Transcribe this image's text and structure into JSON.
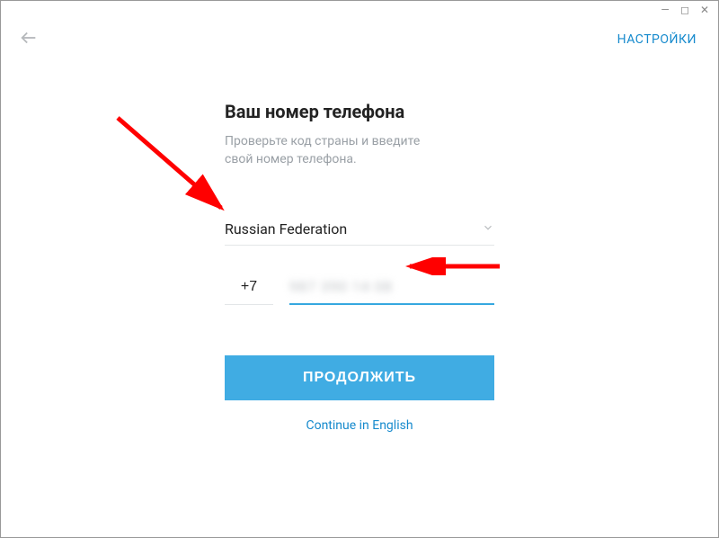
{
  "window": {
    "minimize": "—",
    "maximize": "◻",
    "close": "✕"
  },
  "topbar": {
    "settings": "НАСТРОЙКИ"
  },
  "page": {
    "title": "Ваш номер телефона",
    "subtitle_line1": "Проверьте код страны и введите",
    "subtitle_line2": "свой номер телефона."
  },
  "country": {
    "name": "Russian Federation"
  },
  "phone": {
    "code": "+7",
    "masked": "987 390 14 08"
  },
  "actions": {
    "continue": "ПРОДОЛЖИТЬ",
    "english": "Continue in English"
  }
}
